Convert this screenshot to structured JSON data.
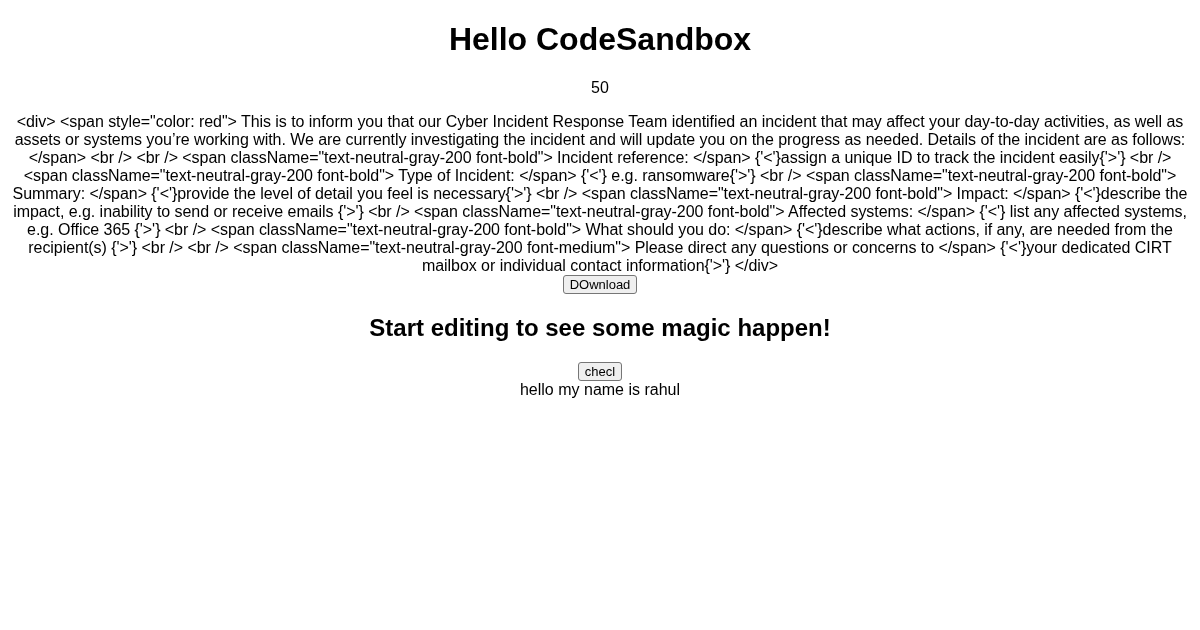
{
  "heading": "Hello CodeSandbox",
  "counter": "50",
  "message": "<div> <span style=\"color: red\"> This is to inform you that our Cyber Incident Response Team identified an incident that may affect your day-to-day activities, as well as assets or systems you’re working with. We are currently investigating the incident and will update you on the progress as needed. Details of the incident are as follows: </span> <br /> <br /> <span className=\"text-neutral-gray-200 font-bold\"> Incident reference: </span> {'<'}assign a unique ID to track the incident easily{'>'} <br /> <span className=\"text-neutral-gray-200 font-bold\"> Type of Incident: </span> {'<'} e.g. ransomware{'>'} <br /> <span className=\"text-neutral-gray-200 font-bold\"> Summary: </span> {'<'}provide the level of detail you feel is necessary{'>'} <br /> <span className=\"text-neutral-gray-200 font-bold\"> Impact: </span> {'<'}describe the impact, e.g. inability to send or receive emails {'>'} <br /> <span className=\"text-neutral-gray-200 font-bold\"> Affected systems: </span> {'<'} list any affected systems, e.g. Office 365 {'>'} <br /> <span className=\"text-neutral-gray-200 font-bold\"> What should you do: </span> {'<'}describe what actions, if any, are needed from the recipient(s) {'>'} <br /> <br /> <span className=\"text-neutral-gray-200 font-medium\"> Please direct any questions or concerns to </span> {'<'}your dedicated CIRT mailbox or individual contact information{'>'} </div>",
  "download_button": "DOwnload",
  "subheading": "Start editing to see some magic happen!",
  "check_button": "checl",
  "greeting": "hello my name is rahul"
}
